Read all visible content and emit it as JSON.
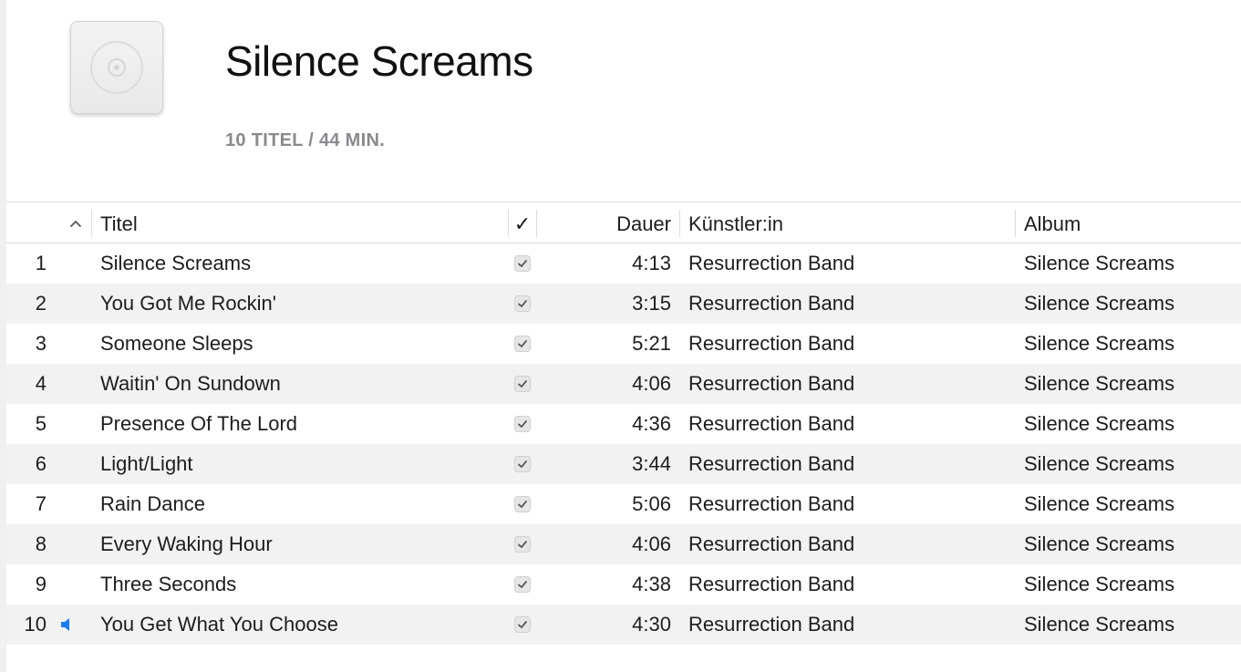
{
  "album": {
    "title": "Silence Screams",
    "meta": "10 TITEL / 44 MIN."
  },
  "columns": {
    "sort_indicator": "^",
    "title": "Titel",
    "check": "✓",
    "duration": "Dauer",
    "artist": "Künstler:in",
    "album": "Album"
  },
  "tracks": [
    {
      "num": "1",
      "title": "Silence Screams",
      "duration": "4:13",
      "artist": "Resurrection Band",
      "album": "Silence Screams",
      "checked": true,
      "playing": false
    },
    {
      "num": "2",
      "title": "You Got Me Rockin'",
      "duration": "3:15",
      "artist": "Resurrection Band",
      "album": "Silence Screams",
      "checked": true,
      "playing": false
    },
    {
      "num": "3",
      "title": "Someone Sleeps",
      "duration": "5:21",
      "artist": "Resurrection Band",
      "album": "Silence Screams",
      "checked": true,
      "playing": false
    },
    {
      "num": "4",
      "title": "Waitin' On Sundown",
      "duration": "4:06",
      "artist": "Resurrection Band",
      "album": "Silence Screams",
      "checked": true,
      "playing": false
    },
    {
      "num": "5",
      "title": "Presence Of The Lord",
      "duration": "4:36",
      "artist": "Resurrection Band",
      "album": "Silence Screams",
      "checked": true,
      "playing": false
    },
    {
      "num": "6",
      "title": "Light/Light",
      "duration": "3:44",
      "artist": "Resurrection Band",
      "album": "Silence Screams",
      "checked": true,
      "playing": false
    },
    {
      "num": "7",
      "title": "Rain Dance",
      "duration": "5:06",
      "artist": "Resurrection Band",
      "album": "Silence Screams",
      "checked": true,
      "playing": false
    },
    {
      "num": "8",
      "title": "Every Waking Hour",
      "duration": "4:06",
      "artist": "Resurrection Band",
      "album": "Silence Screams",
      "checked": true,
      "playing": false
    },
    {
      "num": "9",
      "title": "Three Seconds",
      "duration": "4:38",
      "artist": "Resurrection Band",
      "album": "Silence Screams",
      "checked": true,
      "playing": false
    },
    {
      "num": "10",
      "title": "You Get What You Choose",
      "duration": "4:30",
      "artist": "Resurrection Band",
      "album": "Silence Screams",
      "checked": true,
      "playing": true
    }
  ],
  "icons": {
    "artwork": "cd-placeholder-icon",
    "sort": "chevron-up-icon",
    "checkbox": "checkbox-checked-icon",
    "now_playing": "speaker-icon"
  },
  "colors": {
    "accent": "#1c7cf4",
    "row_alt": "#f2f2f2",
    "meta_text": "#8a8a8e"
  }
}
